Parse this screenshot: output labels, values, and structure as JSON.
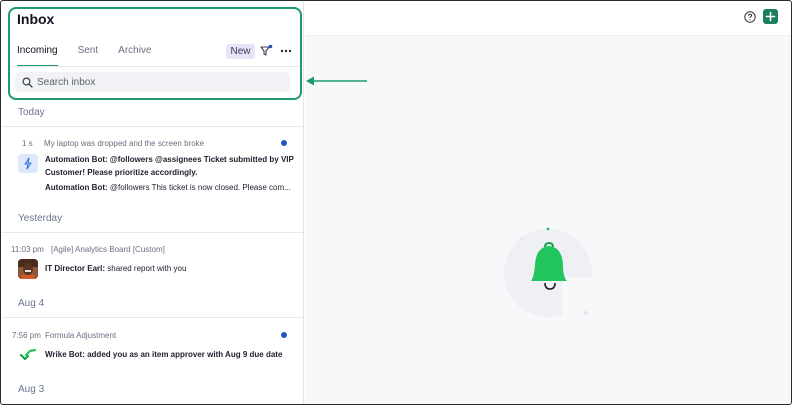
{
  "inbox": {
    "title": "Inbox",
    "tabs": [
      {
        "label": "Incoming",
        "active": true
      },
      {
        "label": "Sent",
        "active": false
      },
      {
        "label": "Archive",
        "active": false
      }
    ],
    "new_label": "New",
    "search_placeholder": "Search inbox"
  },
  "sections": [
    {
      "label": "Today",
      "items": [
        {
          "time": "1 s",
          "subject": "My laptop was dropped and the screen broke",
          "unread": true,
          "icon": "lightning-icon",
          "messages": [
            {
              "author": "Automation Bot:",
              "text": "@followers @assignees Ticket submitted by VIP",
              "text2": "Customer! Please prioritize accordingly."
            },
            {
              "author": "Automation Bot:",
              "text": "@followers This ticket is now closed. Please com..."
            }
          ]
        }
      ]
    },
    {
      "label": "Yesterday",
      "items": [
        {
          "time": "11:03 pm",
          "subject": "[Agile] Analytics Board [Custom]",
          "unread": false,
          "icon": "avatar",
          "messages": [
            {
              "author": "IT Director Earl:",
              "text": "shared report with you"
            }
          ]
        }
      ]
    },
    {
      "label": "Aug 4",
      "items": [
        {
          "time": "7:56 pm",
          "subject": "Formula Adjustment",
          "unread": true,
          "icon": "wrike-check-icon",
          "messages": [
            {
              "author": "Wrike Bot:",
              "text": "added you as an item approver with Aug 9 due date"
            }
          ]
        }
      ]
    },
    {
      "label": "Aug 3",
      "items": []
    }
  ],
  "colors": {
    "accent": "#1d9a73",
    "unread_dot": "#1f56c7",
    "add_button": "#1b7f5c",
    "bell": "#22c55e"
  },
  "icons": [
    "filter-icon",
    "more-icon",
    "search-icon",
    "help-icon",
    "plus-icon",
    "bell-icon",
    "arrow-icon"
  ]
}
